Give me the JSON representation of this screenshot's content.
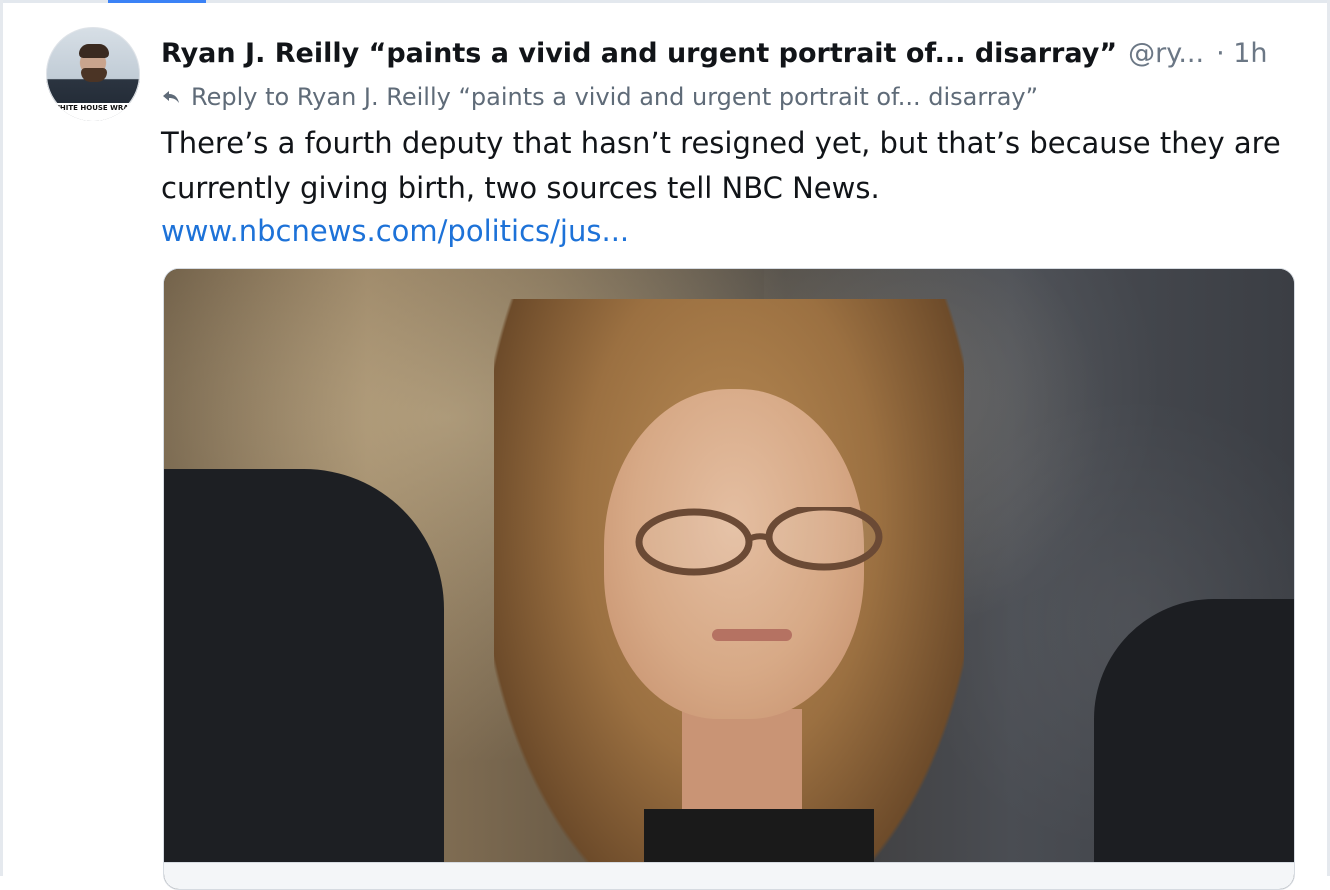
{
  "post": {
    "author": "Ryan J. Reilly “paints a vivid and urgent portrait of... disarray”",
    "handle": "@ry...",
    "time": "· 1h",
    "reply_to": "Reply to Ryan J. Reilly “paints a vivid and urgent portrait of... disarray”",
    "text": "There’s a fourth deputy that hasn’t resigned yet, but that’s because they are currently giving birth, two sources tell NBC News.",
    "link_text": "www.nbcnews.com/politics/jus...",
    "avatar_banner": "WHITE HOUSE WRAP"
  },
  "icons": {
    "reply": "reply-arrow-icon"
  },
  "colors": {
    "text": "#111418",
    "muted": "#6b7785",
    "link": "#1d72d8",
    "accent": "#3b82f6"
  }
}
